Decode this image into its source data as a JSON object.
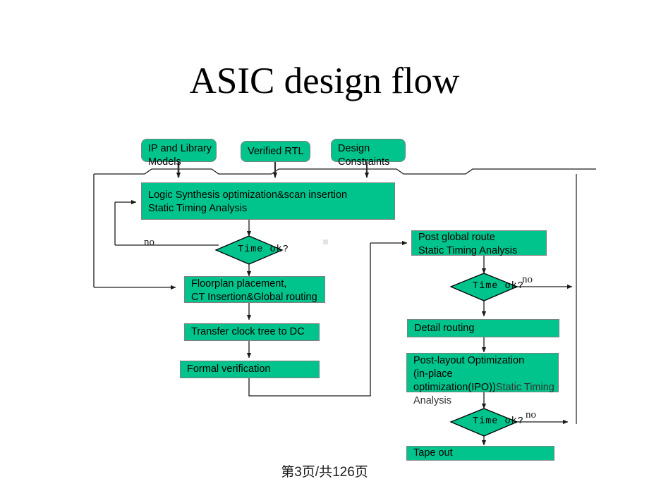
{
  "slide": {
    "title": "ASIC design flow",
    "footer": "第3页/共126页",
    "background_color": "#ffffff",
    "node_fill_color": "#00c48c",
    "node_border_color": "#808080",
    "connector_color": "#1a1a1a"
  },
  "diagram": {
    "type": "flowchart",
    "name": "asic-design-flow",
    "inputs": [
      {
        "id": "ip-and-library-models",
        "label": "IP and Library\nModels",
        "shape": "rounded-rect"
      },
      {
        "id": "verified-rtl",
        "label": "Verified RTL",
        "shape": "rounded-rect"
      },
      {
        "id": "design-constraints",
        "label": "Design\nConstraints",
        "shape": "rounded-rect"
      }
    ],
    "process_nodes": [
      {
        "id": "logic-synthesis",
        "label": "Logic Synthesis optimization&scan insertion\nStatic Timing Analysis",
        "shape": "rect",
        "column": "left"
      },
      {
        "id": "floorplan-placement",
        "label": "Floorplan placement,\nCT Insertion&Global routing",
        "shape": "rect",
        "column": "left"
      },
      {
        "id": "transfer-clock-tree",
        "label": "Transfer clock tree to DC",
        "shape": "rect",
        "column": "left"
      },
      {
        "id": "formal-verification",
        "label": "Formal verification",
        "shape": "rect",
        "column": "left"
      },
      {
        "id": "post-global-route",
        "label": "Post global route\nStatic Timing Analysis",
        "shape": "rect",
        "column": "right"
      },
      {
        "id": "detail-routing",
        "label": "Detail routing",
        "shape": "rect",
        "column": "right"
      },
      {
        "id": "post-layout-optimization",
        "label": "Post-layout Optimization\n(in-place optimization(IPO))",
        "label_line3": "Static Timing Analysis",
        "shape": "rect",
        "column": "right"
      },
      {
        "id": "tape-out",
        "label": "Tape out",
        "shape": "rect",
        "column": "right"
      }
    ],
    "decisions": [
      {
        "id": "time-ok-synthesis",
        "label": "Time ok?",
        "shape": "diamond",
        "no_label": "no"
      },
      {
        "id": "time-ok-post-global-route",
        "label": "Time ok?",
        "shape": "diamond",
        "no_label": "no"
      },
      {
        "id": "time-ok-post-layout",
        "label": "Time ok?",
        "shape": "diamond",
        "no_label": "no"
      }
    ],
    "edge_labels": [
      "no",
      "no",
      "no"
    ]
  }
}
